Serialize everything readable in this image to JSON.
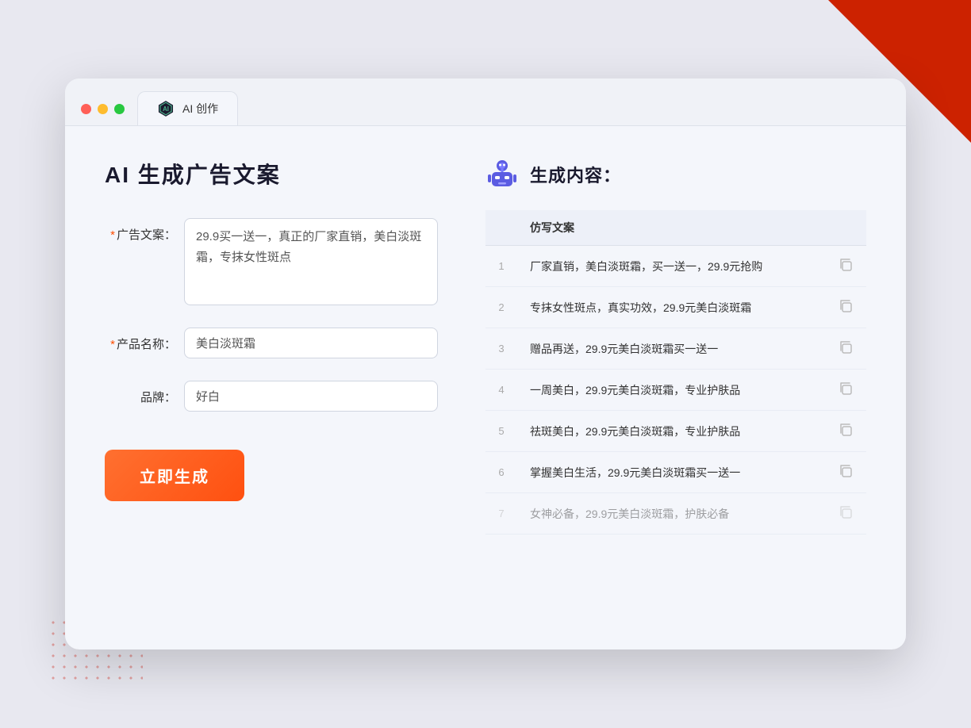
{
  "window": {
    "tab_label": "AI 创作"
  },
  "page": {
    "title": "AI 生成广告文案",
    "right_title": "生成内容："
  },
  "form": {
    "ad_label": "广告文案：",
    "ad_required": "*",
    "ad_value": "29.9买一送一，真正的厂家直销，美白淡斑霜，专抹女性斑点",
    "product_label": "产品名称：",
    "product_required": "*",
    "product_value": "美白淡斑霜",
    "brand_label": "品牌：",
    "brand_value": "好白",
    "generate_btn": "立即生成"
  },
  "results": {
    "column_label": "仿写文案",
    "items": [
      {
        "index": 1,
        "text": "厂家直销，美白淡斑霜，买一送一，29.9元抢购"
      },
      {
        "index": 2,
        "text": "专抹女性斑点，真实功效，29.9元美白淡斑霜"
      },
      {
        "index": 3,
        "text": "赠品再送，29.9元美白淡斑霜买一送一"
      },
      {
        "index": 4,
        "text": "一周美白，29.9元美白淡斑霜，专业护肤品"
      },
      {
        "index": 5,
        "text": "祛斑美白，29.9元美白淡斑霜，专业护肤品"
      },
      {
        "index": 6,
        "text": "掌握美白生活，29.9元美白淡斑霜买一送一"
      },
      {
        "index": 7,
        "text": "女神必备，29.9元美白淡斑霜，护肤必备"
      }
    ]
  }
}
